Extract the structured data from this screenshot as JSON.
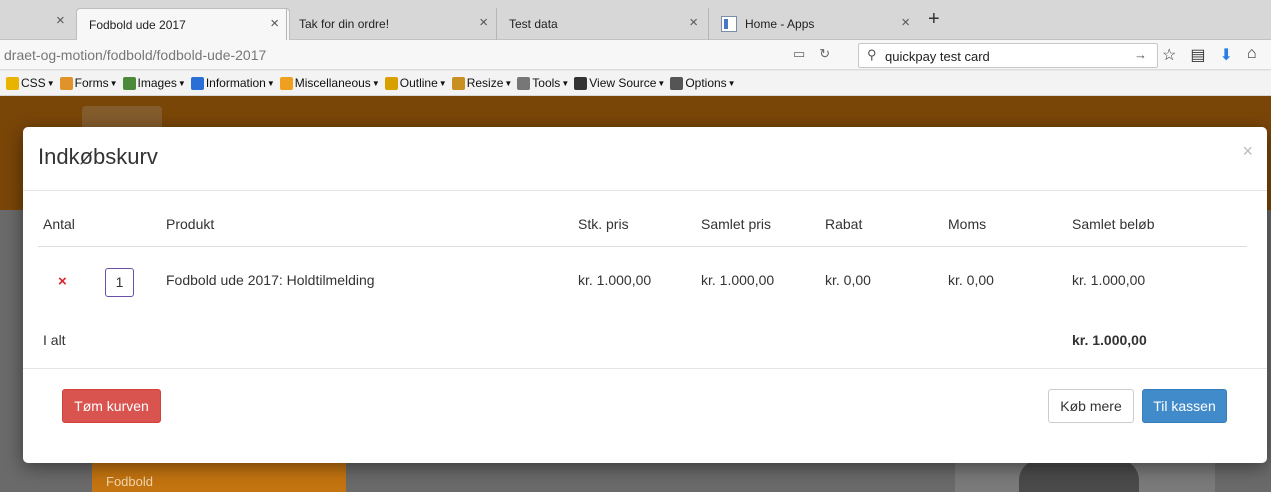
{
  "browser": {
    "tabs": [
      {
        "title": "Fodbold ude 2017",
        "active": true
      },
      {
        "title": "Tak for din ordre!",
        "active": false
      },
      {
        "title": "Test data",
        "active": false
      },
      {
        "title": "Home - Apps",
        "active": false
      }
    ],
    "new_tab_label": "+",
    "close_glyph": "×",
    "url": "draet-og-motion/fodbold/fodbold-ude-2017",
    "search_value": "quickpay test card",
    "icons": [
      "reader-view-icon",
      "reload-icon",
      "search-icon",
      "search-go-icon",
      "bookmark-star-icon",
      "library-icon",
      "download-icon"
    ]
  },
  "devbar": {
    "items": [
      {
        "label": "CSS",
        "icon": "pencil-icon",
        "color": "#e8b400"
      },
      {
        "label": "Forms",
        "icon": "clipboard-icon",
        "color": "#e0932a"
      },
      {
        "label": "Images",
        "icon": "image-icon",
        "color": "#4a8a3a"
      },
      {
        "label": "Information",
        "icon": "info-icon",
        "color": "#2a6fd6"
      },
      {
        "label": "Miscellaneous",
        "icon": "folder-icon",
        "color": "#f0a020"
      },
      {
        "label": "Outline",
        "icon": "pencil-icon",
        "color": "#d8a000"
      },
      {
        "label": "Resize",
        "icon": "pencil-icon",
        "color": "#c89020"
      },
      {
        "label": "Tools",
        "icon": "tools-icon",
        "color": "#777777"
      },
      {
        "label": "View Source",
        "icon": "console-icon",
        "color": "#333333"
      },
      {
        "label": "Options",
        "icon": "options-icon",
        "color": "#555555"
      }
    ]
  },
  "page": {
    "sidebar_label": "Fodbold"
  },
  "modal": {
    "title": "Indkøbskurv",
    "close_glyph": "×",
    "columns": {
      "antal": "Antal",
      "produkt": "Produkt",
      "stk_pris": "Stk. pris",
      "samlet_pris": "Samlet pris",
      "rabat": "Rabat",
      "moms": "Moms",
      "samlet_beloeb": "Samlet beløb"
    },
    "rows": [
      {
        "remove_glyph": "×",
        "quantity": "1",
        "product": "Fodbold ude 2017: Holdtilmelding",
        "unit_price": "kr. 1.000,00",
        "total_price": "kr. 1.000,00",
        "discount": "kr. 0,00",
        "vat": "kr. 0,00",
        "amount": "kr. 1.000,00"
      }
    ],
    "total_label": "I alt",
    "total_value": "kr. 1.000,00",
    "buttons": {
      "empty_cart": "Tøm kurven",
      "buy_more": "Køb mere",
      "checkout": "Til kassen"
    }
  }
}
